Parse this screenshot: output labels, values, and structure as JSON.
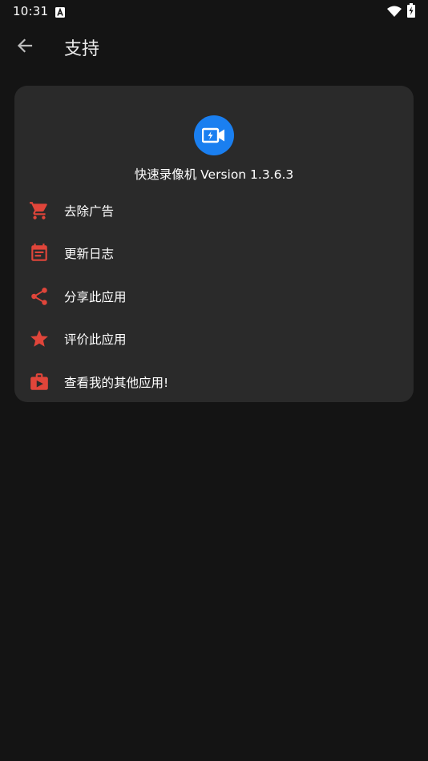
{
  "status_bar": {
    "time": "10:31",
    "app_icon": "a-square-icon",
    "wifi_icon": "wifi-icon",
    "battery_icon": "battery-charging-icon"
  },
  "app_bar": {
    "back_icon": "arrow-left-icon",
    "title": "支持"
  },
  "about_card": {
    "app_icon": "video-camera-flash-icon",
    "app_name_version": "快速录像机 Version 1.3.6.3",
    "items": [
      {
        "icon": "cart-icon",
        "label": "去除广告"
      },
      {
        "icon": "calendar-icon",
        "label": "更新日志"
      },
      {
        "icon": "share-icon",
        "label": "分享此应用"
      },
      {
        "icon": "star-icon",
        "label": "评价此应用"
      },
      {
        "icon": "play-store-bag-icon",
        "label": "查看我的其他应用!"
      }
    ]
  },
  "colors": {
    "background": "#141414",
    "card": "#2a2a2a",
    "accent_red": "#e0453a",
    "logo_blue": "#1a7ff0"
  }
}
